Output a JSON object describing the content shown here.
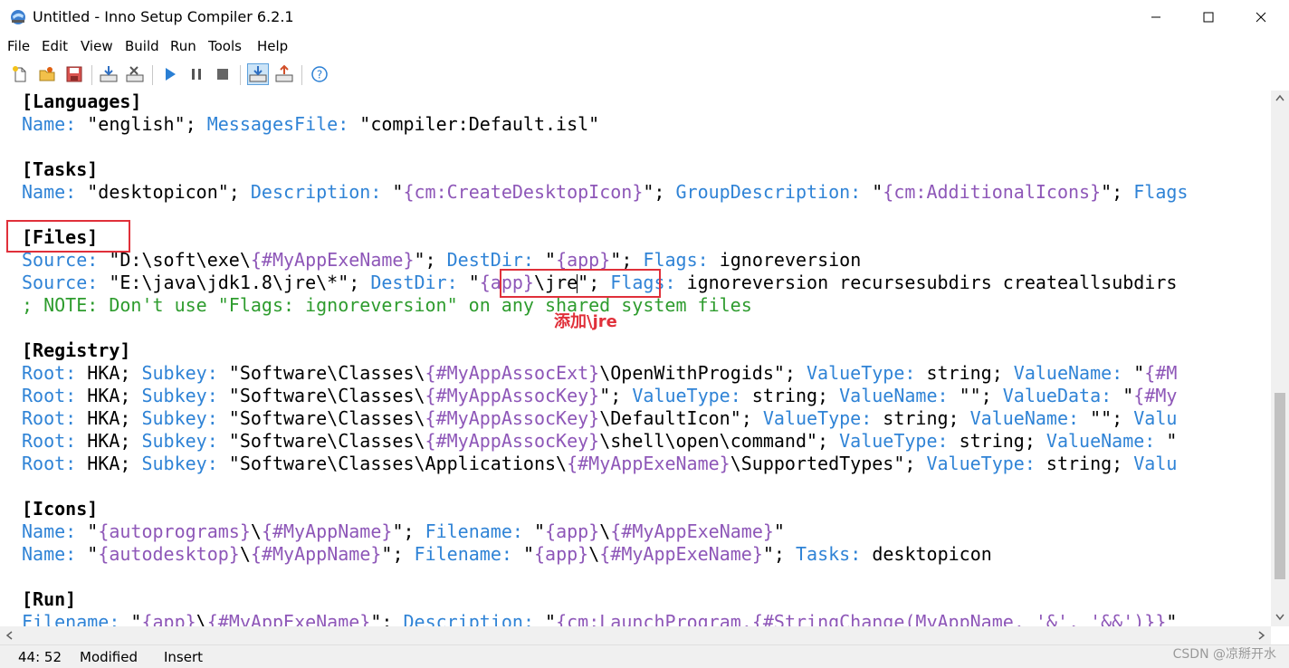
{
  "window": {
    "title": "Untitled - Inno Setup Compiler 6.2.1"
  },
  "menu": {
    "items": [
      "File",
      "Edit",
      "View",
      "Build",
      "Run",
      "Tools",
      "Help"
    ]
  },
  "toolbar": {
    "buttons": [
      "new-file-icon",
      "open-folder-icon",
      "save-icon",
      "compile-icon",
      "stop-compile-icon",
      "run-icon",
      "pause-icon",
      "terminate-icon",
      "target-setup-icon",
      "target-uninstall-icon",
      "help-icon"
    ]
  },
  "editor": {
    "lines": [
      [
        [
          "sec",
          "[Languages]"
        ]
      ],
      [
        [
          "kw",
          "Name"
        ],
        [
          "kw",
          ":"
        ],
        [
          "t",
          " \"english\"; "
        ],
        [
          "kw",
          "MessagesFile"
        ],
        [
          "kw",
          ":"
        ],
        [
          "t",
          " \"compiler:Default.isl\""
        ]
      ],
      [],
      [
        [
          "sec",
          "[Tasks]"
        ]
      ],
      [
        [
          "kw",
          "Name"
        ],
        [
          "kw",
          ":"
        ],
        [
          "t",
          " \"desktopicon\"; "
        ],
        [
          "kw",
          "Description"
        ],
        [
          "kw",
          ":"
        ],
        [
          "t",
          " \""
        ],
        [
          "cst",
          "{cm:CreateDesktopIcon}"
        ],
        [
          "t",
          "\"; "
        ],
        [
          "kw",
          "GroupDescription"
        ],
        [
          "kw",
          ":"
        ],
        [
          "t",
          " \""
        ],
        [
          "cst",
          "{cm:AdditionalIcons}"
        ],
        [
          "t",
          "\"; "
        ],
        [
          "kw",
          "Flags"
        ]
      ],
      [],
      [
        [
          "sec",
          "[Files]"
        ]
      ],
      [
        [
          "kw",
          "Source"
        ],
        [
          "kw",
          ":"
        ],
        [
          "t",
          " \"D:\\soft\\exe\\"
        ],
        [
          "cst",
          "{#MyAppExeName}"
        ],
        [
          "t",
          "\"; "
        ],
        [
          "kw",
          "DestDir"
        ],
        [
          "kw",
          ":"
        ],
        [
          "t",
          " \""
        ],
        [
          "cst",
          "{app}"
        ],
        [
          "t",
          "\"; "
        ],
        [
          "kw",
          "Flags"
        ],
        [
          "kw",
          ":"
        ],
        [
          "t",
          " ignoreversion"
        ]
      ],
      [
        [
          "kw",
          "Source"
        ],
        [
          "kw",
          ":"
        ],
        [
          "t",
          " \"E:\\java\\jdk1.8\\jre\\*\"; "
        ],
        [
          "kw",
          "DestDir"
        ],
        [
          "kw",
          ":"
        ],
        [
          "t",
          " \""
        ],
        [
          "cst",
          "{app}"
        ],
        [
          "t",
          "\\jre"
        ],
        [
          "caret",
          ""
        ],
        [
          "t",
          "\"; "
        ],
        [
          "kw",
          "Flags"
        ],
        [
          "kw",
          ":"
        ],
        [
          "t",
          " ignoreversion recursesubdirs createallsubdirs"
        ]
      ],
      [
        [
          "cmt",
          "; NOTE: Don't use \"Flags: ignoreversion\" on any shared system files"
        ]
      ],
      [],
      [
        [
          "sec",
          "[Registry]"
        ]
      ],
      [
        [
          "kw",
          "Root"
        ],
        [
          "kw",
          ":"
        ],
        [
          "t",
          " HKA; "
        ],
        [
          "kw",
          "Subkey"
        ],
        [
          "kw",
          ":"
        ],
        [
          "t",
          " \"Software\\Classes\\"
        ],
        [
          "cst",
          "{#MyAppAssocExt}"
        ],
        [
          "t",
          "\\OpenWithProgids\"; "
        ],
        [
          "kw",
          "ValueType"
        ],
        [
          "kw",
          ":"
        ],
        [
          "t",
          " string; "
        ],
        [
          "kw",
          "ValueName"
        ],
        [
          "kw",
          ":"
        ],
        [
          "t",
          " \""
        ],
        [
          "cst",
          "{#M"
        ]
      ],
      [
        [
          "kw",
          "Root"
        ],
        [
          "kw",
          ":"
        ],
        [
          "t",
          " HKA; "
        ],
        [
          "kw",
          "Subkey"
        ],
        [
          "kw",
          ":"
        ],
        [
          "t",
          " \"Software\\Classes\\"
        ],
        [
          "cst",
          "{#MyAppAssocKey}"
        ],
        [
          "t",
          "\"; "
        ],
        [
          "kw",
          "ValueType"
        ],
        [
          "kw",
          ":"
        ],
        [
          "t",
          " string; "
        ],
        [
          "kw",
          "ValueName"
        ],
        [
          "kw",
          ":"
        ],
        [
          "t",
          " \"\"; "
        ],
        [
          "kw",
          "ValueData"
        ],
        [
          "kw",
          ":"
        ],
        [
          "t",
          " \""
        ],
        [
          "cst",
          "{#My"
        ]
      ],
      [
        [
          "kw",
          "Root"
        ],
        [
          "kw",
          ":"
        ],
        [
          "t",
          " HKA; "
        ],
        [
          "kw",
          "Subkey"
        ],
        [
          "kw",
          ":"
        ],
        [
          "t",
          " \"Software\\Classes\\"
        ],
        [
          "cst",
          "{#MyAppAssocKey}"
        ],
        [
          "t",
          "\\DefaultIcon\"; "
        ],
        [
          "kw",
          "ValueType"
        ],
        [
          "kw",
          ":"
        ],
        [
          "t",
          " string; "
        ],
        [
          "kw",
          "ValueName"
        ],
        [
          "kw",
          ":"
        ],
        [
          "t",
          " \"\"; "
        ],
        [
          "kw",
          "Valu"
        ]
      ],
      [
        [
          "kw",
          "Root"
        ],
        [
          "kw",
          ":"
        ],
        [
          "t",
          " HKA; "
        ],
        [
          "kw",
          "Subkey"
        ],
        [
          "kw",
          ":"
        ],
        [
          "t",
          " \"Software\\Classes\\"
        ],
        [
          "cst",
          "{#MyAppAssocKey}"
        ],
        [
          "t",
          "\\shell\\open\\command\"; "
        ],
        [
          "kw",
          "ValueType"
        ],
        [
          "kw",
          ":"
        ],
        [
          "t",
          " string; "
        ],
        [
          "kw",
          "ValueName"
        ],
        [
          "kw",
          ":"
        ],
        [
          "t",
          " \""
        ]
      ],
      [
        [
          "kw",
          "Root"
        ],
        [
          "kw",
          ":"
        ],
        [
          "t",
          " HKA; "
        ],
        [
          "kw",
          "Subkey"
        ],
        [
          "kw",
          ":"
        ],
        [
          "t",
          " \"Software\\Classes\\Applications\\"
        ],
        [
          "cst",
          "{#MyAppExeName}"
        ],
        [
          "t",
          "\\SupportedTypes\"; "
        ],
        [
          "kw",
          "ValueType"
        ],
        [
          "kw",
          ":"
        ],
        [
          "t",
          " string; "
        ],
        [
          "kw",
          "Valu"
        ]
      ],
      [],
      [
        [
          "sec",
          "[Icons]"
        ]
      ],
      [
        [
          "kw",
          "Name"
        ],
        [
          "kw",
          ":"
        ],
        [
          "t",
          " \""
        ],
        [
          "cst",
          "{autoprograms}"
        ],
        [
          "t",
          "\\"
        ],
        [
          "cst",
          "{#MyAppName}"
        ],
        [
          "t",
          "\"; "
        ],
        [
          "kw",
          "Filename"
        ],
        [
          "kw",
          ":"
        ],
        [
          "t",
          " \""
        ],
        [
          "cst",
          "{app}"
        ],
        [
          "t",
          "\\"
        ],
        [
          "cst",
          "{#MyAppExeName}"
        ],
        [
          "t",
          "\""
        ]
      ],
      [
        [
          "kw",
          "Name"
        ],
        [
          "kw",
          ":"
        ],
        [
          "t",
          " \""
        ],
        [
          "cst",
          "{autodesktop}"
        ],
        [
          "t",
          "\\"
        ],
        [
          "cst",
          "{#MyAppName}"
        ],
        [
          "t",
          "\"; "
        ],
        [
          "kw",
          "Filename"
        ],
        [
          "kw",
          ":"
        ],
        [
          "t",
          " \""
        ],
        [
          "cst",
          "{app}"
        ],
        [
          "t",
          "\\"
        ],
        [
          "cst",
          "{#MyAppExeName}"
        ],
        [
          "t",
          "\"; "
        ],
        [
          "kw",
          "Tasks"
        ],
        [
          "kw",
          ":"
        ],
        [
          "t",
          " desktopicon"
        ]
      ],
      [],
      [
        [
          "sec",
          "[Run]"
        ]
      ],
      [
        [
          "kw",
          "Filename"
        ],
        [
          "kw",
          ":"
        ],
        [
          "t",
          " \""
        ],
        [
          "cst",
          "{app}"
        ],
        [
          "t",
          "\\"
        ],
        [
          "cst",
          "{#MyAppExeName}"
        ],
        [
          "t",
          "\"; "
        ],
        [
          "kw",
          "Description"
        ],
        [
          "kw",
          ":"
        ],
        [
          "t",
          " \""
        ],
        [
          "cst",
          "{cm:LaunchProgram,{#StringChange(MyAppName, '&', '&&')}}"
        ],
        [
          "t",
          "\""
        ]
      ]
    ]
  },
  "annotation": {
    "text": "添加\\jre"
  },
  "status": {
    "position": "44: 52",
    "modified": "Modified",
    "mode": "Insert"
  },
  "watermark": "CSDN @凉掰开水",
  "colors": {
    "keyword": "#2f83d6",
    "constant": "#8e57b8",
    "comment": "#2e9c2e",
    "highlight_box": "#e0303a"
  }
}
